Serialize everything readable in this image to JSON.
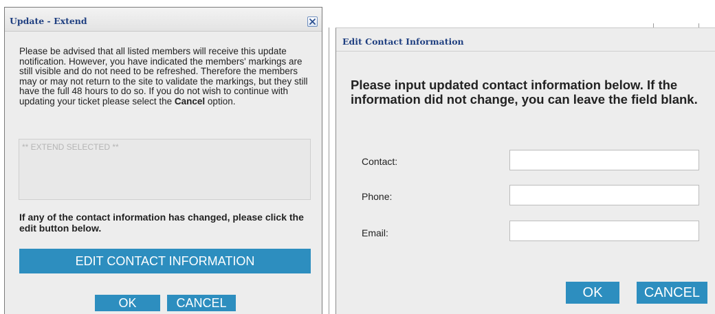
{
  "update_dialog": {
    "title": "Update - Extend",
    "notice_text": "Please be advised that all listed members will receive this update notification. However, you have indicated the members' markings are still visible and do not need to be refreshed. Therefore the members may or may not return to the site to validate the markings, but they still have the full 48 hours to do so. If you do not wish to continue with updating your ticket please select the ",
    "notice_bold": "Cancel",
    "notice_tail": " option.",
    "extend_selected_text": "** EXTEND SELECTED **",
    "contact_note": "If any of the contact information has changed, please click the edit button below.",
    "edit_contact_label": "EDIT CONTACT INFORMATION",
    "ok_label": "OK",
    "cancel_label": "CANCEL"
  },
  "contact_dialog": {
    "title": "Edit Contact Information",
    "instructions": "Please input updated contact information below. If the information did not change, you can leave the field blank.",
    "fields": [
      {
        "label": "Contact:",
        "value": "",
        "placeholder": ""
      },
      {
        "label": "Phone:",
        "value": "",
        "placeholder": ""
      },
      {
        "label": "Email:",
        "value": "",
        "placeholder": ""
      }
    ],
    "ok_label": "OK",
    "cancel_label": "CANCEL"
  },
  "colors": {
    "accent_button": "#2d8ebf",
    "title_text": "#1f3f80",
    "dialog_background": "#ededed"
  },
  "icons": {
    "close": "close-icon"
  }
}
